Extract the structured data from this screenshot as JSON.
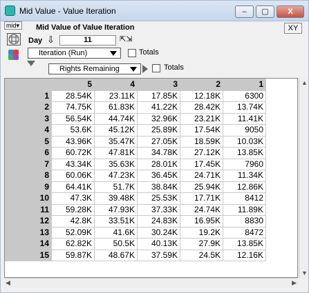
{
  "window": {
    "title": "Mid Value - Value Iteration",
    "min_label": "–",
    "max_label": "▢",
    "close_label": "X"
  },
  "toolbar": {
    "mid_dropdown": "mid▾",
    "header_title": "Mid Value of Value Iteration",
    "xy_label": "XY",
    "day_label": "Day",
    "day_value": "11",
    "iteration_dropdown": "Iteration (Run)",
    "totals_label": "Totals",
    "rights_dropdown": "Rights Remaining",
    "totals2_label": "Totals"
  },
  "table": {
    "columns": [
      "5",
      "4",
      "3",
      "2",
      "1"
    ],
    "rows": [
      {
        "label": "1",
        "cells": [
          "28.54K",
          "23.11K",
          "17.85K",
          "12.18K",
          "6300"
        ]
      },
      {
        "label": "2",
        "cells": [
          "74.75K",
          "61.83K",
          "41.22K",
          "28.42K",
          "13.74K"
        ]
      },
      {
        "label": "3",
        "cells": [
          "56.54K",
          "44.74K",
          "32.96K",
          "23.21K",
          "11.41K"
        ]
      },
      {
        "label": "4",
        "cells": [
          "53.6K",
          "45.12K",
          "25.89K",
          "17.54K",
          "9050"
        ]
      },
      {
        "label": "5",
        "cells": [
          "43.96K",
          "35.47K",
          "27.05K",
          "18.59K",
          "10.03K"
        ]
      },
      {
        "label": "6",
        "cells": [
          "60.72K",
          "47.81K",
          "34.78K",
          "27.12K",
          "13.85K"
        ]
      },
      {
        "label": "7",
        "cells": [
          "43.34K",
          "35.63K",
          "28.01K",
          "17.45K",
          "7960"
        ]
      },
      {
        "label": "8",
        "cells": [
          "60.06K",
          "47.23K",
          "36.45K",
          "24.71K",
          "11.34K"
        ]
      },
      {
        "label": "9",
        "cells": [
          "64.41K",
          "51.7K",
          "38.84K",
          "25.94K",
          "12.86K"
        ]
      },
      {
        "label": "10",
        "cells": [
          "47.3K",
          "39.48K",
          "25.53K",
          "17.71K",
          "8412"
        ]
      },
      {
        "label": "11",
        "cells": [
          "59.28K",
          "47.93K",
          "37.33K",
          "24.74K",
          "11.89K"
        ]
      },
      {
        "label": "12",
        "cells": [
          "42.8K",
          "33.51K",
          "24.83K",
          "16.95K",
          "8830"
        ]
      },
      {
        "label": "13",
        "cells": [
          "52.09K",
          "41.6K",
          "30.24K",
          "19.2K",
          "8472"
        ]
      },
      {
        "label": "14",
        "cells": [
          "62.82K",
          "50.5K",
          "40.13K",
          "27.9K",
          "13.85K"
        ]
      },
      {
        "label": "15",
        "cells": [
          "59.87K",
          "48.67K",
          "37.59K",
          "24.5K",
          "12.16K"
        ]
      }
    ]
  }
}
